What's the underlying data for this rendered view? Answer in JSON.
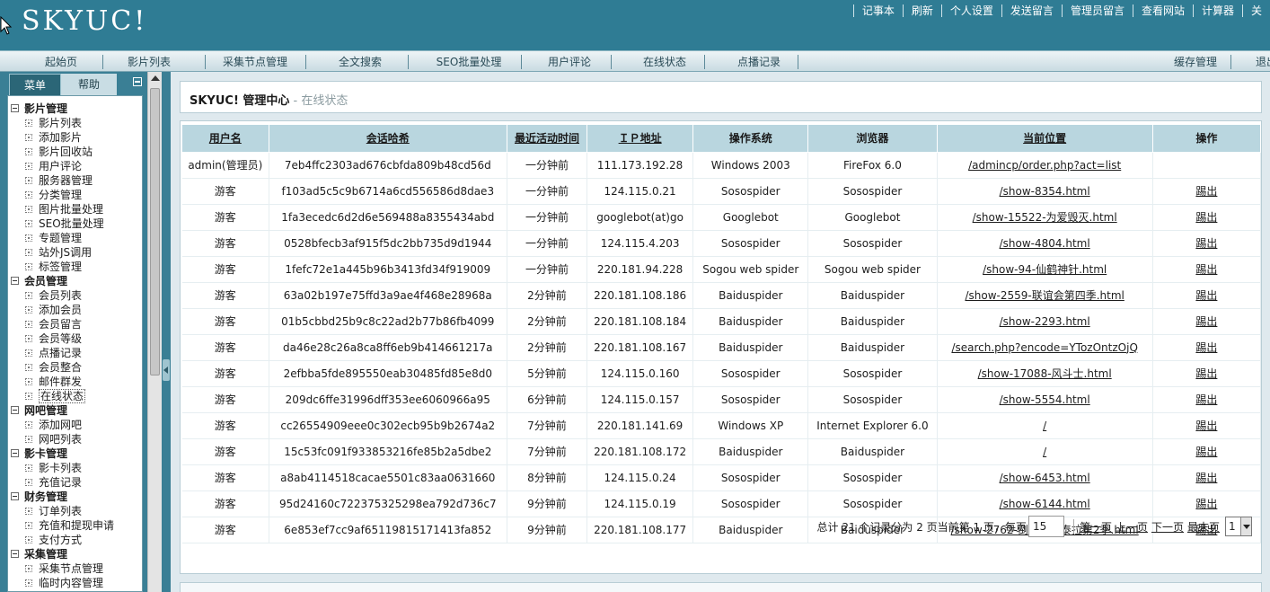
{
  "app": {
    "logo": "SKYUC!"
  },
  "top_links": [
    "记事本",
    "刷新",
    "个人设置",
    "发送留言",
    "管理员留言",
    "查看网站",
    "计算器",
    "关"
  ],
  "nav": {
    "items": [
      "起始页",
      "影片列表",
      "采集节点管理",
      "全文搜索",
      "SEO批量处理",
      "用户评论",
      "在线状态",
      "点播记录"
    ],
    "right_items": [
      "缓存管理",
      "退出"
    ]
  },
  "sidebar": {
    "tab_menu": "菜单",
    "tab_help": "帮助",
    "groups": [
      {
        "label": "影片管理",
        "items": [
          "影片列表",
          "添加影片",
          "影片回收站",
          "用户评论",
          "服务器管理",
          "分类管理",
          "图片批量处理",
          "SEO批量处理",
          "专题管理",
          "站外JS调用",
          "标签管理"
        ]
      },
      {
        "label": "会员管理",
        "items": [
          "会员列表",
          "添加会员",
          "会员留言",
          "会员等级",
          "点播记录",
          "会员整合",
          "邮件群发",
          "在线状态"
        ]
      },
      {
        "label": "网吧管理",
        "items": [
          "添加网吧",
          "网吧列表"
        ]
      },
      {
        "label": "影卡管理",
        "items": [
          "影卡列表",
          "充值记录"
        ]
      },
      {
        "label": "财务管理",
        "items": [
          "订单列表",
          "充值和提现申请",
          "支付方式"
        ]
      },
      {
        "label": "采集管理",
        "items": [
          "采集节点管理",
          "临时内容管理"
        ]
      }
    ],
    "active_item": "在线状态"
  },
  "page": {
    "title": "SKYUC! 管理中心",
    "subtitle": " - 在线状态"
  },
  "table": {
    "headers": [
      "用户名",
      "会话哈希",
      "最近活动时间",
      "ＩＰ地址",
      "操作系统",
      "浏览器",
      "当前位置",
      "操作"
    ],
    "rows": [
      [
        "admin(管理员)",
        "7eb4ffc2303ad676cbfda809b48cd56d",
        "一分钟前",
        "111.173.192.28",
        "Windows 2003",
        "FireFox 6.0",
        "/admincp/order.php?act=list",
        ""
      ],
      [
        "游客",
        "f103ad5c5c9b6714a6cd556586d8dae3",
        "一分钟前",
        "124.115.0.21",
        "Sosospider",
        "Sosospider",
        "/show-8354.html",
        "踢出"
      ],
      [
        "游客",
        "1fa3ecedc6d2d6e569488a8355434abd",
        "一分钟前",
        "googlebot(at)go",
        "Googlebot",
        "Googlebot",
        "/show-15522-为爱毁灭.html",
        "踢出"
      ],
      [
        "游客",
        "0528bfecb3af915f5dc2bb735d9d1944",
        "一分钟前",
        "124.115.4.203",
        "Sosospider",
        "Sosospider",
        "/show-4804.html",
        "踢出"
      ],
      [
        "游客",
        "1fefc72e1a445b96b3413fd34f919009",
        "一分钟前",
        "220.181.94.228",
        "Sogou web spider",
        "Sogou web spider",
        "/show-94-仙鹤神针.html",
        "踢出"
      ],
      [
        "游客",
        "63a02b197e75ffd3a9ae4f468e28968a",
        "2分钟前",
        "220.181.108.186",
        "Baiduspider",
        "Baiduspider",
        "/show-2559-联谊会第四季.html",
        "踢出"
      ],
      [
        "游客",
        "01b5cbbd25b9c8c22ad2b77b86fb4099",
        "2分钟前",
        "220.181.108.184",
        "Baiduspider",
        "Baiduspider",
        "/show-2293.html",
        "踢出"
      ],
      [
        "游客",
        "da46e28c26a8ca8ff6eb9b414661217a",
        "2分钟前",
        "220.181.108.167",
        "Baiduspider",
        "Baiduspider",
        "/search.php?encode=YTozOntzOjQ",
        "踢出"
      ],
      [
        "游客",
        "2efbba5fde895550eab30485fd85e8d0",
        "5分钟前",
        "124.115.0.160",
        "Sosospider",
        "Sosospider",
        "/show-17088-风斗士.html",
        "踢出"
      ],
      [
        "游客",
        "209dc6ffe31996dff353ee6060966a95",
        "6分钟前",
        "124.115.0.157",
        "Sosospider",
        "Sosospider",
        "/show-5554.html",
        "踢出"
      ],
      [
        "游客",
        "cc26554909eee0c302ecb95b9b2674a2",
        "7分钟前",
        "220.181.141.69",
        "Windows XP",
        "Internet Explorer 6.0",
        "/",
        "踢出"
      ],
      [
        "游客",
        "15c53fc091f933853216fe85b2a5dbe2",
        "7分钟前",
        "220.181.108.172",
        "Baiduspider",
        "Baiduspider",
        "/",
        "踢出"
      ],
      [
        "游客",
        "a8ab4114518cacae5501c83aa0631660",
        "8分钟前",
        "124.115.0.24",
        "Sosospider",
        "Sosospider",
        "/show-6453.html",
        "踢出"
      ],
      [
        "游客",
        "95d24160c722375325298ea792d736c7",
        "9分钟前",
        "124.115.0.19",
        "Sosospider",
        "Sosospider",
        "/show-6144.html",
        "踢出"
      ],
      [
        "游客",
        "6e853ef7cc9af65119815171413fa852",
        "9分钟前",
        "220.181.108.177",
        "Baiduspider",
        "Baiduspider",
        "/show-2762-倒错人生泰拉第2季.html",
        "踢出"
      ]
    ]
  },
  "pager": {
    "summary": "总计 21 个记录分为 2 页当前第 1 页，每页",
    "per_page": "15",
    "first": "第一页",
    "prev": "上一页",
    "next": "下一页",
    "last": "最末页",
    "page_select": "1"
  },
  "colors": {
    "header_bg": "#2f7c94",
    "table_header_bg": "#b9d6df",
    "sidebar_bg": "#3a7f95"
  }
}
